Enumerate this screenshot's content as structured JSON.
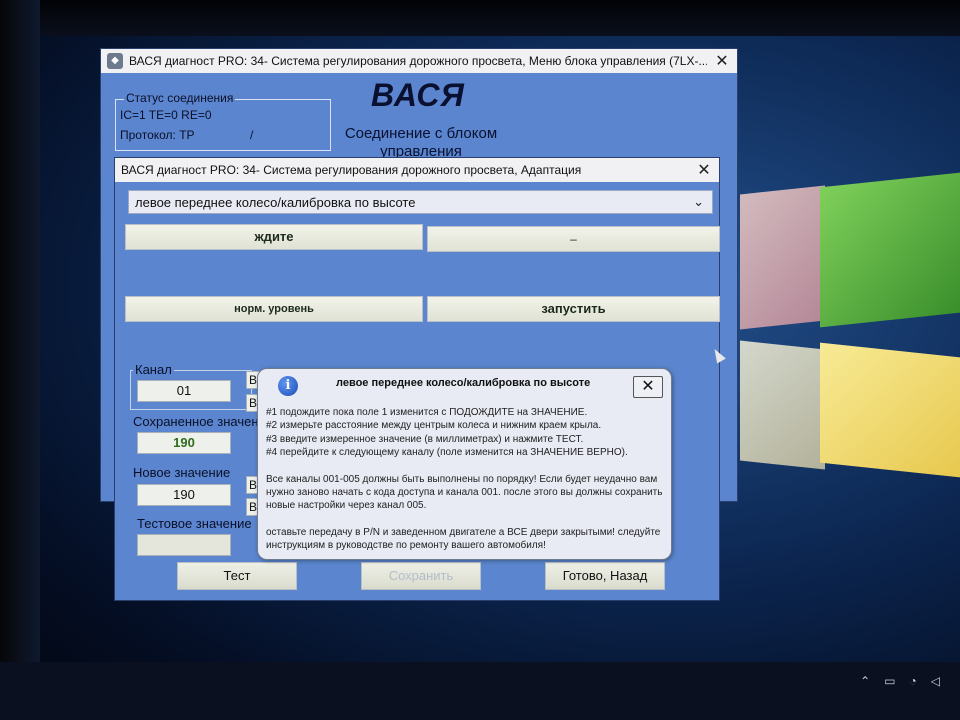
{
  "main_window": {
    "title": "ВАСЯ диагност PRO: 34- Система регулирования дорожного просвета,  Меню блока управления (7LX-...",
    "close": "✕",
    "status": {
      "legend": "Статус соединения",
      "line1": "IC=1  TE=0   RE=0",
      "line2": "Протокол: TP",
      "slash": "/"
    },
    "brand": "ВАСЯ",
    "connection_text": "Соединение с блоком управления"
  },
  "adaptation_window": {
    "title": "ВАСЯ диагност PRO: 34- Система регулирования дорожного просвета, Адаптация",
    "close": "✕",
    "channel_select": "левое переднее колесо/калибровка по высоте",
    "status_left": "ждите",
    "status_right": "–",
    "norm_button": "норм. уровень",
    "start_button": "запустить",
    "channel_label": "Канал",
    "channel_value": "01",
    "stored_label": "Сохраненное значение",
    "stored_value": "190",
    "new_label": "Новое значение",
    "new_value": "190",
    "test_label": "Тестовое значение",
    "test_value": "",
    "side_btn_1": "В",
    "side_btn_2": "В",
    "side_btn_3": "В",
    "side_btn_4": "В",
    "test_button": "Тест",
    "save_button": "Сохранить",
    "done_button": "Готово, Назад"
  },
  "message_box": {
    "title": "левое переднее колесо/калибровка по высоте",
    "close": "✕",
    "step1": "#1 подождите пока поле 1 изменится с ПОДОЖДИТЕ на ЗНАЧЕНИЕ.",
    "step2": "#2 измерьте расстояние между центрым колеса и нижним краем крыла.",
    "step3": "#3 введите измеренное значение (в миллиметрах) и нажмите ТЕСТ.",
    "step4": "#4 перейдите к следующему каналу (поле изменится на ЗНАЧЕНИЕ ВЕРНО).",
    "note1": "Все каналы 001-005 должны быть выполнены по порядку! Если будет неудачно вам нужно заново начать с кода доступа и канала 001. после этого вы должны сохранить новые настройки через канал 005.",
    "note2": "оставьте передачу в P/N и заведенном двигателе а ВСЕ двери закрытыми! следуйте инструкциям в руководстве по ремонту вашего автомобиля!"
  },
  "colors": {
    "window_bg": "#5b86cf",
    "stored_value": "#2f6b1c"
  }
}
